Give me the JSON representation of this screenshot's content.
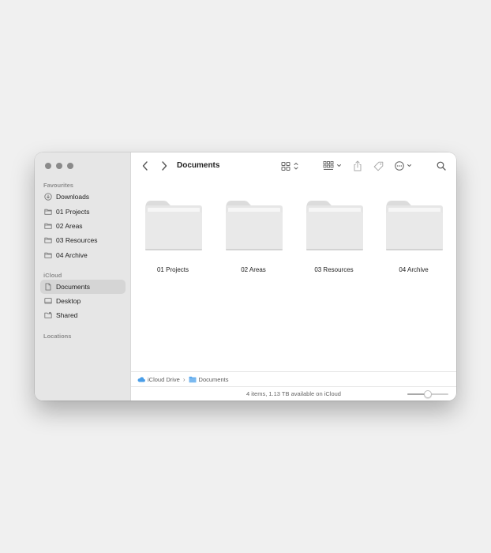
{
  "window": {
    "title": "Documents"
  },
  "sidebar": {
    "sections": [
      {
        "title": "Favourites",
        "items": [
          {
            "label": "Downloads",
            "icon": "download-icon"
          },
          {
            "label": "01 Projects",
            "icon": "folder-icon"
          },
          {
            "label": "02 Areas",
            "icon": "folder-icon"
          },
          {
            "label": "03 Resources",
            "icon": "folder-icon"
          },
          {
            "label": "04 Archive",
            "icon": "folder-icon"
          }
        ]
      },
      {
        "title": "iCloud",
        "items": [
          {
            "label": "Documents",
            "icon": "document-icon",
            "selected": true
          },
          {
            "label": "Desktop",
            "icon": "desktop-icon"
          },
          {
            "label": "Shared",
            "icon": "shared-folder-icon"
          }
        ]
      },
      {
        "title": "Locations",
        "items": []
      }
    ]
  },
  "main": {
    "folders": [
      {
        "label": "01 Projects"
      },
      {
        "label": "02 Areas"
      },
      {
        "label": "03 Resources"
      },
      {
        "label": "04 Archive"
      }
    ]
  },
  "pathbar": {
    "root": "iCloud Drive",
    "current": "Documents"
  },
  "statusbar": {
    "text": "4 items, 1.13 TB available on iCloud",
    "icon_size_level": 0.5
  },
  "colors": {
    "sidebar_bg": "#e6e6e6",
    "selected_bg": "#d5d5d5",
    "folder_fill": "#e9e9e9",
    "icloud_blue": "#4a9ee8"
  }
}
